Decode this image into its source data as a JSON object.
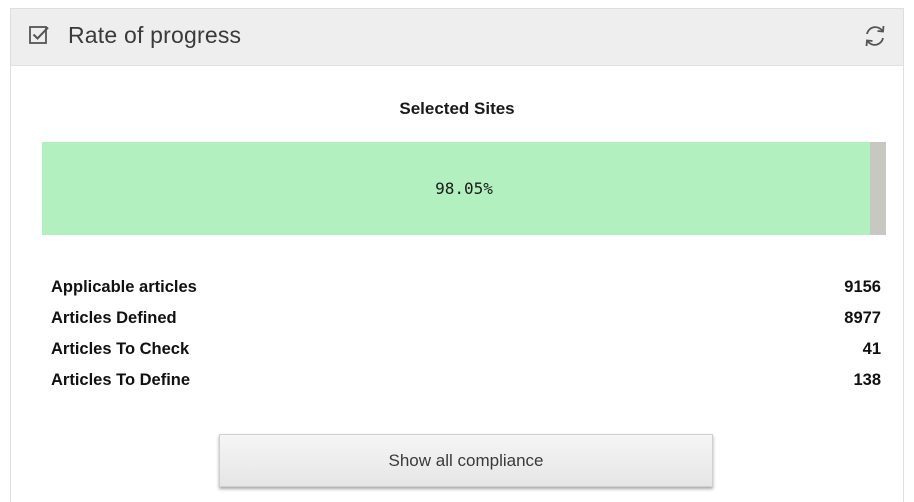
{
  "widget": {
    "title": "Rate of progress",
    "header_icon": "checkbox-checked-icon",
    "refresh_icon": "refresh-icon"
  },
  "progress": {
    "section_title": "Selected Sites",
    "label": "98.05%",
    "percent": 98.05,
    "fill_color": "#b3f0bf",
    "track_color": "#c8c8c2"
  },
  "stats": [
    {
      "label": "Applicable articles",
      "value": "9156"
    },
    {
      "label": "Articles Defined",
      "value": "8977"
    },
    {
      "label": "Articles To Check",
      "value": "41"
    },
    {
      "label": "Articles To Define",
      "value": "138"
    }
  ],
  "actions": {
    "show_all_label": "Show all compliance"
  }
}
